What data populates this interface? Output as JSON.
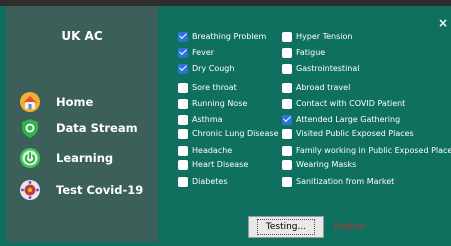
{
  "app": {
    "title": "UK AC",
    "close_glyph": "×"
  },
  "nav": [
    {
      "label": "Home",
      "icon": "home-icon"
    },
    {
      "label": "Data Stream",
      "icon": "shield-icon"
    },
    {
      "label": "Learning",
      "icon": "power-icon"
    },
    {
      "label": "Test Covid-19",
      "icon": "virus-icon"
    }
  ],
  "symptoms_left": [
    {
      "label": "Breathing Problem",
      "checked": true
    },
    {
      "label": "Fever",
      "checked": true
    },
    {
      "label": "Dry Cough",
      "checked": true
    },
    {
      "label": "Sore throat",
      "checked": false
    },
    {
      "label": "Running Nose",
      "checked": false
    },
    {
      "label": "Asthma",
      "checked": false
    },
    {
      "label": "Chronic Lung Disease",
      "checked": false
    },
    {
      "label": "Headache",
      "checked": false
    },
    {
      "label": "Heart Disease",
      "checked": false
    },
    {
      "label": "Diabetes",
      "checked": false
    }
  ],
  "symptoms_right": [
    {
      "label": "Hyper Tension",
      "checked": false
    },
    {
      "label": "Fatigue",
      "checked": false
    },
    {
      "label": "Gastrointestinal",
      "checked": false
    },
    {
      "label": "Abroad travel",
      "checked": false
    },
    {
      "label": "Contact with COVID Patient",
      "checked": false
    },
    {
      "label": "Attended Large Gathering",
      "checked": true
    },
    {
      "label": "Visited Public Exposed Places",
      "checked": false
    },
    {
      "label": "Family working in Public Exposed Places",
      "checked": false
    },
    {
      "label": "Wearing Masks",
      "checked": false
    },
    {
      "label": "Sanitization from Market",
      "checked": false
    }
  ],
  "actions": {
    "test_label": "Testing...",
    "result": "Positive"
  },
  "colors": {
    "panel": "#0f7060",
    "sidebar": "#3c5f59",
    "checkbox_checked": "#2d73d8",
    "result": "#d12b2b"
  }
}
